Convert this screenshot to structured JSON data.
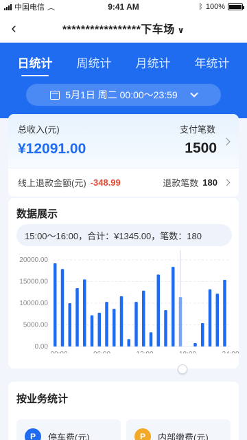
{
  "status_bar": {
    "carrier": "中国电信",
    "time": "9:41 AM",
    "battery": "100%"
  },
  "nav": {
    "title": "*****************下车场"
  },
  "tabs": [
    {
      "label": "日统计",
      "active": true
    },
    {
      "label": "周统计",
      "active": false
    },
    {
      "label": "月统计",
      "active": false
    },
    {
      "label": "年统计",
      "active": false
    }
  ],
  "date_range": "5月1日 周二 00:00～23:59",
  "income": {
    "total_label": "总收入(元)",
    "total_value": "¥12091.00",
    "count_label": "支付笔数",
    "count_value": "1500",
    "refund_label": "线上退款金额(元)",
    "refund_value": "-348.99",
    "refund_count_label": "退款笔数",
    "refund_count_value": "180"
  },
  "chart_section": {
    "title": "数据展示",
    "tooltip": "15:00～16:00，合计：¥1345.00，笔数：180"
  },
  "chart_data": {
    "type": "bar",
    "y_ticks": [
      "0.00",
      "5000.00",
      "10000.00",
      "15000.00",
      "20000.00"
    ],
    "x_ticks": [
      "00:00",
      "06:00",
      "12:00",
      "18:00",
      "24:00"
    ],
    "ylim": [
      0,
      20000
    ],
    "hours": [
      0,
      1,
      2,
      3,
      4,
      5,
      6,
      7,
      8,
      9,
      10,
      11,
      12,
      13,
      14,
      15,
      16,
      17,
      18,
      19,
      20,
      21,
      22,
      23,
      24
    ],
    "values": [
      19200,
      17900,
      10000,
      13500,
      15500,
      7200,
      7800,
      10300,
      8700,
      11600,
      1700,
      10300,
      12900,
      3300,
      16600,
      8400,
      18400,
      11400,
      0,
      800,
      5400,
      13200,
      12200,
      15400,
      0
    ],
    "highlight_index": 17,
    "bar_color": "#1f6cf0",
    "highlight_color": "#7aa6f5"
  },
  "business": {
    "title": "按业务统计",
    "items": [
      {
        "label": "停车费(元)",
        "icon_text": "P",
        "color": "#1f6cf0"
      },
      {
        "label": "内部缴费(元)",
        "icon_text": "P",
        "color": "#f3a928"
      }
    ]
  }
}
